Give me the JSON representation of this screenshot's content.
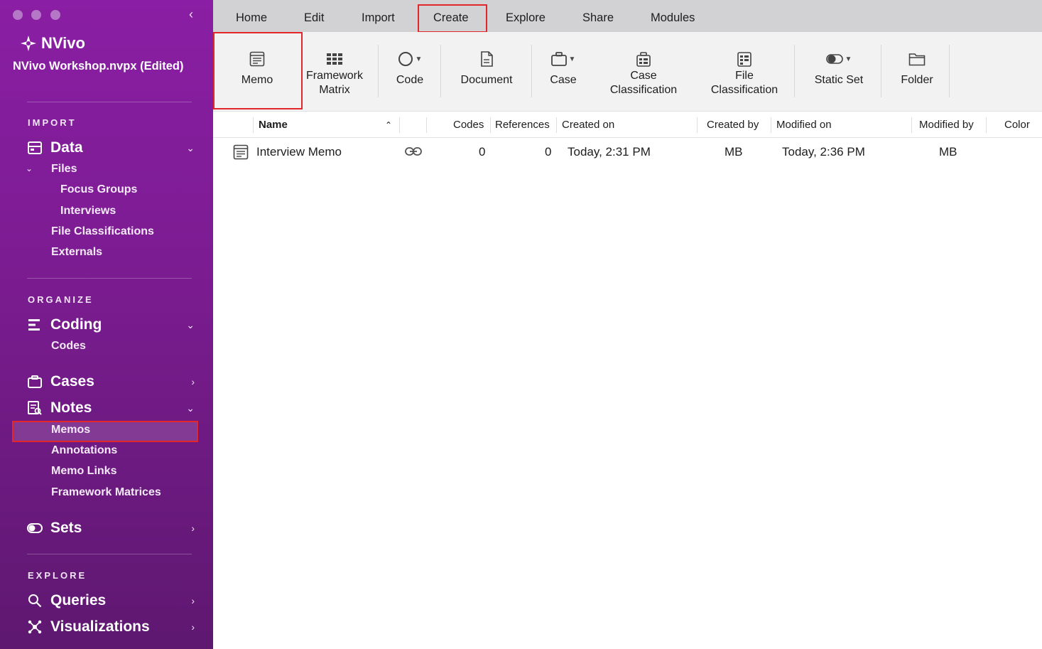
{
  "sidebar": {
    "app_name": "NVivo",
    "project": "NVivo Workshop.nvpx (Edited)",
    "sections": {
      "import": "IMPORT",
      "organize": "ORGANIZE",
      "explore": "EXPLORE"
    },
    "groups": {
      "data": "Data",
      "coding": "Coding",
      "cases": "Cases",
      "notes": "Notes",
      "sets": "Sets",
      "queries": "Queries",
      "visualizations": "Visualizations"
    },
    "items": {
      "files": "Files",
      "focus_groups": "Focus Groups",
      "interviews": "Interviews",
      "file_classifications": "File Classifications",
      "externals": "Externals",
      "codes": "Codes",
      "memos": "Memos",
      "annotations": "Annotations",
      "memo_links": "Memo Links",
      "framework_matrices": "Framework Matrices"
    }
  },
  "menu": [
    "Home",
    "Edit",
    "Import",
    "Create",
    "Explore",
    "Share",
    "Modules"
  ],
  "ribbon": {
    "memo": "Memo",
    "framework_1": "Framework",
    "framework_2": "Matrix",
    "code": "Code",
    "document": "Document",
    "case": "Case",
    "case_class_1": "Case",
    "case_class_2": "Classification",
    "file_class_1": "File",
    "file_class_2": "Classification",
    "static_set": "Static Set",
    "folder": "Folder"
  },
  "table": {
    "columns": {
      "name": "Name",
      "codes": "Codes",
      "references": "References",
      "created_on": "Created on",
      "created_by": "Created by",
      "modified_on": "Modified on",
      "modified_by": "Modified by",
      "color": "Color"
    },
    "rows": [
      {
        "name": "Interview Memo",
        "codes": "0",
        "references": "0",
        "created_on": "Today, 2:31 PM",
        "created_by": "MB",
        "modified_on": "Today, 2:36 PM",
        "modified_by": "MB"
      }
    ]
  },
  "colors": {
    "sidebar_top": "#8a1ea4",
    "sidebar_bottom": "#5e1870",
    "highlight_red": "#e3262a"
  }
}
